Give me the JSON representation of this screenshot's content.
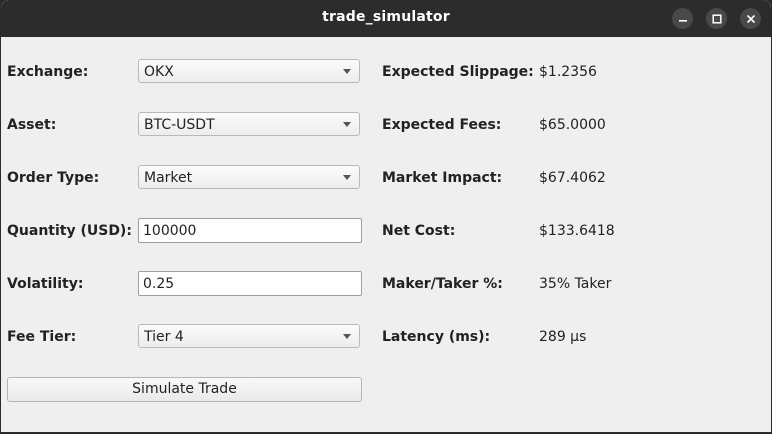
{
  "window": {
    "title": "trade_simulator",
    "controls": {
      "minimize_icon": "minimize-icon",
      "maximize_icon": "maximize-icon",
      "close_icon": "close-icon"
    }
  },
  "form": {
    "exchange": {
      "label": "Exchange:",
      "value": "OKX"
    },
    "asset": {
      "label": "Asset:",
      "value": "BTC-USDT"
    },
    "order_type": {
      "label": "Order Type:",
      "value": "Market"
    },
    "quantity": {
      "label": "Quantity (USD):",
      "value": "100000"
    },
    "volatility": {
      "label": "Volatility:",
      "value": "0.25"
    },
    "fee_tier": {
      "label": "Fee Tier:",
      "value": "Tier 4"
    },
    "simulate_button": "Simulate Trade"
  },
  "results": {
    "slippage": {
      "label": "Expected Slippage:",
      "value": "$1.2356"
    },
    "fees": {
      "label": "Expected Fees:",
      "value": "$65.0000"
    },
    "impact": {
      "label": "Market Impact:",
      "value": "$67.4062"
    },
    "net_cost": {
      "label": "Net Cost:",
      "value": "$133.6418"
    },
    "maker_taker": {
      "label": "Maker/Taker %:",
      "value": "35% Taker"
    },
    "latency": {
      "label": "Latency (ms):",
      "value": "289 μs"
    }
  },
  "colors": {
    "titlebar": "#2c2c2c",
    "window_bg": "#efefef",
    "control_button": "#494949"
  }
}
